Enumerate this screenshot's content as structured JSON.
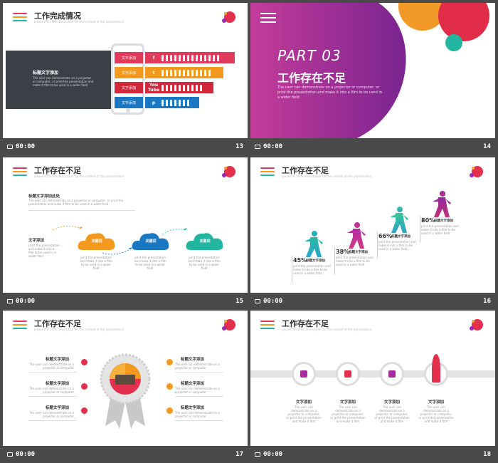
{
  "footer_time": "00:00",
  "slides": [
    {
      "num": "13",
      "title": "工作完成情况",
      "subtitle": "please fill in the description for the content of the presentation",
      "box_title": "标题文字添加",
      "box_text": "The user can demonstrate on a projector or computer, or print the presentation and make it film to be used in a wider field",
      "bars": [
        {
          "label": "文字添加",
          "icon": "f"
        },
        {
          "label": "文字添加",
          "icon": "t"
        },
        {
          "label": "文字添加",
          "icon": "You Tube"
        },
        {
          "label": "文字添加",
          "icon": "p"
        }
      ],
      "colors": [
        "#e23a5a",
        "#f39a1e",
        "#d1283c",
        "#1a78c2"
      ]
    },
    {
      "num": "14",
      "part": "PART 03",
      "title": "工作存在不足",
      "text": "The user can demonstrate on a projector or computer, or print the presentation and make it into a film to be used in a wider field"
    },
    {
      "num": "15",
      "title": "工作存在不足",
      "subtitle": "please fill in the description for the content of the presentation",
      "head_title": "标题文字添加此处",
      "head_text": "The user can demonstrate on a projector or computer, or print the presentation and make it film to be used in a wider field",
      "side_title": "文字添加",
      "side_text": "print the presentation and make it into a film to be used in a wider field",
      "clouds": [
        {
          "label": "关键词",
          "text": "print the presentation and make it into a film to be used in a wider field"
        },
        {
          "label": "关键词",
          "text": "print the presentation and make it into a film to be used in a wider field"
        },
        {
          "label": "关键词",
          "text": "print the presentation and make it into a film to be used in a wider field"
        }
      ]
    },
    {
      "num": "16",
      "steps": [
        {
          "pct": "45%",
          "label": "标题文字添加",
          "text": "print the presentation and make it into a film to be used in a wider field"
        },
        {
          "pct": "38%",
          "label": "标题文字添加",
          "text": "print the presentation and make it into a film to be used in a wider field"
        },
        {
          "pct": "66%",
          "label": "标题文字添加",
          "text": "print the presentation and make it into a film to be used in a wider field"
        },
        {
          "pct": "80%",
          "label": "标题文字添加",
          "text": "print the presentation and make it into a film to be used in a wider field"
        }
      ]
    },
    {
      "num": "17",
      "title": "工作存在不足",
      "subtitle": "please fill in the description for the content of the presentation",
      "items": [
        {
          "title": "标题文字添加",
          "text": "The user can demonstrate on a projector or computer"
        },
        {
          "title": "标题文字添加",
          "text": "The user can demonstrate on a projector or computer"
        },
        {
          "title": "标题文字添加",
          "text": "The user can demonstrate on a projector or computer"
        },
        {
          "title": "标题文字添加",
          "text": "The user can demonstrate on a projector or computer"
        },
        {
          "title": "标题文字添加",
          "text": "The user can demonstrate on a projector or computer"
        },
        {
          "title": "标题文字添加",
          "text": "The user can demonstrate on a projector or computer"
        }
      ]
    },
    {
      "num": "18",
      "title": "工作存在不足",
      "subtitle": "please fill in the description for the content of the presentation",
      "items": [
        {
          "title": "文字添加",
          "text": "The user can demonstrate on a projector or computer, or print the presentation and make it film"
        },
        {
          "title": "文字添加",
          "text": "The user can demonstrate on a projector or computer, or print the presentation and make it film"
        },
        {
          "title": "文字添加",
          "text": "The user can demonstrate on a projector or computer, or print the presentation and make it film"
        },
        {
          "title": "文字添加",
          "text": "The user can demonstrate on a projector or computer, or print the presentation and make it film"
        }
      ]
    }
  ]
}
